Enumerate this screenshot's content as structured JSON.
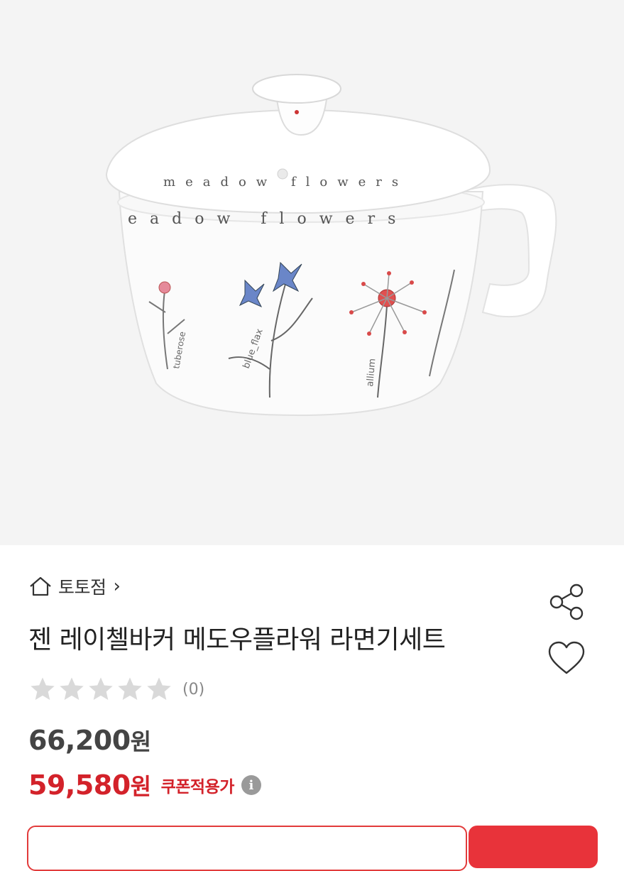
{
  "product_image": {
    "icon": "ramen-pot-product-photo",
    "lid_text": "meadow flowers",
    "bowl_text": "eadow flowers",
    "flower_labels": [
      "tuberose",
      "blue_flax",
      "allium"
    ]
  },
  "shop": {
    "icon": "home-icon",
    "name": "토토점",
    "chevron": "›"
  },
  "product": {
    "title": "젠 레이첼바커 메도우플라워 라면기세트"
  },
  "actions": {
    "share_icon": "share-icon",
    "wishlist_icon": "heart-icon"
  },
  "rating": {
    "stars_filled": 0,
    "stars_total": 5,
    "review_count": "(0)"
  },
  "price": {
    "original_number": "66,200",
    "original_unit": "원",
    "sale_number": "59,580",
    "sale_unit": "원",
    "coupon_label": "쿠폰적용가",
    "info_icon_glyph": "i"
  },
  "colors": {
    "sale_red": "#d3222a",
    "button_red": "#e8333a",
    "hero_bg": "#f4f4f4",
    "star_empty": "#d9d9d9"
  }
}
